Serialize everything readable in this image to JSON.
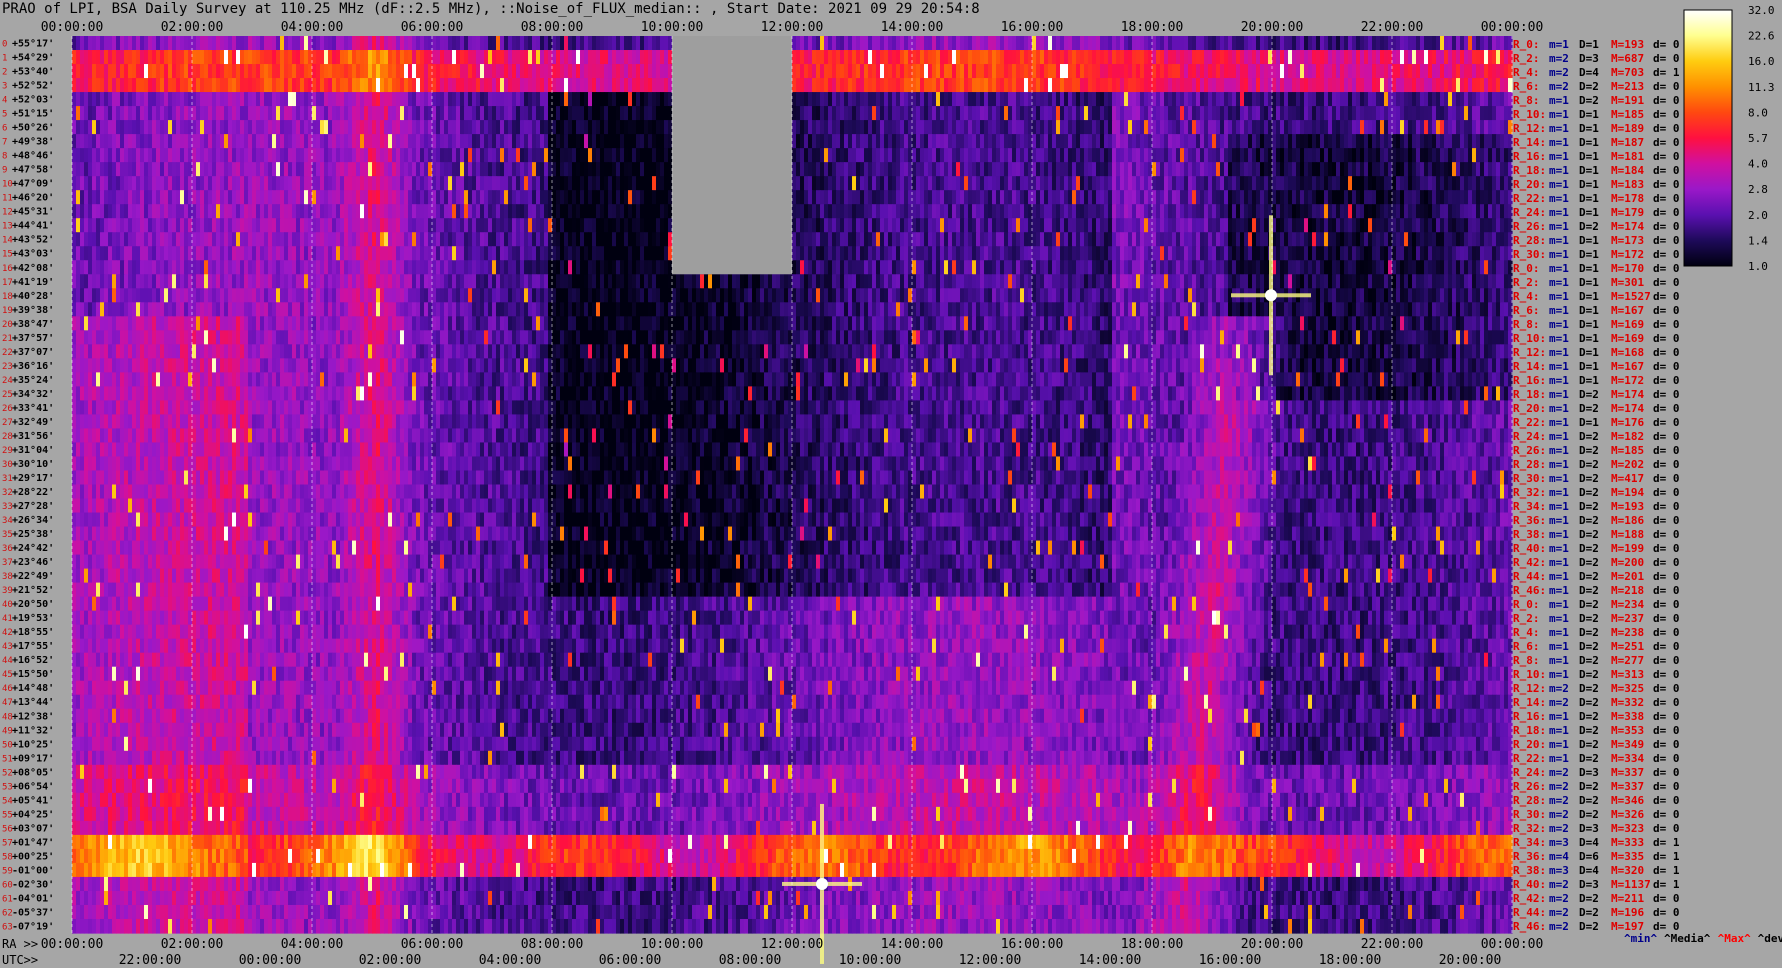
{
  "title": "PRAO of LPI, BSA Daily Survey at 110.25 MHz (dF::2.5 MHz), ::Noise_of_FLUX_median:: , Start Date: 2021 09 29 20:54:8",
  "chart_data": {
    "type": "heatmap",
    "top_time_labels": [
      "00:00:00",
      "02:00:00",
      "04:00:00",
      "06:00:00",
      "08:00:00",
      "10:00:00",
      "12:00:00",
      "14:00:00",
      "16:00:00",
      "18:00:00",
      "20:00:00",
      "22:00:00",
      "00:00:00"
    ],
    "ra_label": "RA >>",
    "ra_ticks": [
      "00:00:00",
      "02:00:00",
      "04:00:00",
      "06:00:00",
      "08:00:00",
      "10:00:00",
      "12:00:00",
      "14:00:00",
      "16:00:00",
      "18:00:00",
      "20:00:00",
      "22:00:00",
      "00:00:00"
    ],
    "utc_label": "UTC>>",
    "utc_ticks": [
      "22:00:00",
      "00:00:00",
      "02:00:00",
      "04:00:00",
      "06:00:00",
      "08:00:00",
      "10:00:00",
      "12:00:00",
      "14:00:00",
      "16:00:00",
      "18:00:00",
      "20:00:00"
    ],
    "declinations": [
      "+55°17'",
      "+54°29'",
      "+53°40'",
      "+52°52'",
      "+52°03'",
      "+51°15'",
      "+50°26'",
      "+49°38'",
      "+48°46'",
      "+47°58'",
      "+47°09'",
      "+46°20'",
      "+45°31'",
      "+44°41'",
      "+43°52'",
      "+43°03'",
      "+42°08'",
      "+41°19'",
      "+40°28'",
      "+39°38'",
      "+38°47'",
      "+37°57'",
      "+37°07'",
      "+36°16'",
      "+35°24'",
      "+34°32'",
      "+33°41'",
      "+32°49'",
      "+31°56'",
      "+31°04'",
      "+30°10'",
      "+29°17'",
      "+28°22'",
      "+27°28'",
      "+26°34'",
      "+25°38'",
      "+24°42'",
      "+23°46'",
      "+22°49'",
      "+21°52'",
      "+20°50'",
      "+19°53'",
      "+18°55'",
      "+17°55'",
      "+16°52'",
      "+15°50'",
      "+14°48'",
      "+13°44'",
      "+12°38'",
      "+11°32'",
      "+10°25'",
      "+09°17'",
      "+08°05'",
      "+06°54'",
      "+05°41'",
      "+04°25'",
      "+03°07'",
      "+01°47'",
      "+00°25'",
      "-01°00'",
      "-02°30'",
      "-04°01'",
      "-05°37'",
      "-07°19'"
    ],
    "colorbar_ticks": [
      "32.0",
      "22.6",
      "16.0",
      "11.3",
      "8.0",
      "5.7",
      "4.0",
      "2.8",
      "2.0",
      "1.4",
      "1.0"
    ],
    "colorbar_colors": [
      "#000010",
      "#1e0a5a",
      "#5a10b0",
      "#9a18c8",
      "#d010a0",
      "#ff1040",
      "#ff4810",
      "#ff9000",
      "#ffcc10",
      "#ffff90",
      "#ffffff"
    ],
    "color_scale": "log",
    "masked_region": {
      "ra_from": "10:00:00",
      "ra_to": "12:00:00",
      "dec_from": "+55°17'",
      "dec_to": "+42°08'"
    },
    "bright_sources": [
      {
        "ra": "19:59:00",
        "dec": "+40°28'",
        "name_shown": false
      },
      {
        "ra": "12:30:00",
        "dec": "-02°30'",
        "name_shown": false
      }
    ],
    "stats": [
      {
        "r": "R_0:",
        "m": "m=1",
        "d": "D=1",
        "mx": "M=193",
        "dv": "d= 0"
      },
      {
        "r": "R_2:",
        "m": "m=2",
        "d": "D=3",
        "mx": "M=687",
        "dv": "d= 0"
      },
      {
        "r": "R_4:",
        "m": "m=2",
        "d": "D=4",
        "mx": "M=703",
        "dv": "d= 1"
      },
      {
        "r": "R_6:",
        "m": "m=2",
        "d": "D=2",
        "mx": "M=213",
        "dv": "d= 0"
      },
      {
        "r": "R_8:",
        "m": "m=1",
        "d": "D=2",
        "mx": "M=191",
        "dv": "d= 0"
      },
      {
        "r": "R_10:",
        "m": "m=1",
        "d": "D=1",
        "mx": "M=185",
        "dv": "d= 0"
      },
      {
        "r": "R_12:",
        "m": "m=1",
        "d": "D=1",
        "mx": "M=189",
        "dv": "d= 0"
      },
      {
        "r": "R_14:",
        "m": "m=1",
        "d": "D=1",
        "mx": "M=187",
        "dv": "d= 0"
      },
      {
        "r": "R_16:",
        "m": "m=1",
        "d": "D=1",
        "mx": "M=181",
        "dv": "d= 0"
      },
      {
        "r": "R_18:",
        "m": "m=1",
        "d": "D=1",
        "mx": "M=184",
        "dv": "d= 0"
      },
      {
        "r": "R_20:",
        "m": "m=1",
        "d": "D=1",
        "mx": "M=183",
        "dv": "d= 0"
      },
      {
        "r": "R_22:",
        "m": "m=1",
        "d": "D=1",
        "mx": "M=178",
        "dv": "d= 0"
      },
      {
        "r": "R_24:",
        "m": "m=1",
        "d": "D=1",
        "mx": "M=179",
        "dv": "d= 0"
      },
      {
        "r": "R_26:",
        "m": "m=1",
        "d": "D=2",
        "mx": "M=174",
        "dv": "d= 0"
      },
      {
        "r": "R_28:",
        "m": "m=1",
        "d": "D=1",
        "mx": "M=173",
        "dv": "d= 0"
      },
      {
        "r": "R_30:",
        "m": "m=1",
        "d": "D=1",
        "mx": "M=172",
        "dv": "d= 0"
      },
      {
        "r": "R_0:",
        "m": "m=1",
        "d": "D=1",
        "mx": "M=170",
        "dv": "d= 0"
      },
      {
        "r": "R_2:",
        "m": "m=1",
        "d": "D=1",
        "mx": "M=301",
        "dv": "d= 0"
      },
      {
        "r": "R_4:",
        "m": "m=1",
        "d": "D=1",
        "mx": "M=1527",
        "dv": "d= 0"
      },
      {
        "r": "R_6:",
        "m": "m=1",
        "d": "D=1",
        "mx": "M=167",
        "dv": "d= 0"
      },
      {
        "r": "R_8:",
        "m": "m=1",
        "d": "D=1",
        "mx": "M=169",
        "dv": "d= 0"
      },
      {
        "r": "R_10:",
        "m": "m=1",
        "d": "D=1",
        "mx": "M=169",
        "dv": "d= 0"
      },
      {
        "r": "R_12:",
        "m": "m=1",
        "d": "D=1",
        "mx": "M=168",
        "dv": "d= 0"
      },
      {
        "r": "R_14:",
        "m": "m=1",
        "d": "D=1",
        "mx": "M=167",
        "dv": "d= 0"
      },
      {
        "r": "R_16:",
        "m": "m=1",
        "d": "D=1",
        "mx": "M=172",
        "dv": "d= 0"
      },
      {
        "r": "R_18:",
        "m": "m=1",
        "d": "D=2",
        "mx": "M=174",
        "dv": "d= 0"
      },
      {
        "r": "R_20:",
        "m": "m=1",
        "d": "D=2",
        "mx": "M=174",
        "dv": "d= 0"
      },
      {
        "r": "R_22:",
        "m": "m=1",
        "d": "D=1",
        "mx": "M=176",
        "dv": "d= 0"
      },
      {
        "r": "R_24:",
        "m": "m=1",
        "d": "D=2",
        "mx": "M=182",
        "dv": "d= 0"
      },
      {
        "r": "R_26:",
        "m": "m=1",
        "d": "D=2",
        "mx": "M=185",
        "dv": "d= 0"
      },
      {
        "r": "R_28:",
        "m": "m=1",
        "d": "D=2",
        "mx": "M=202",
        "dv": "d= 0"
      },
      {
        "r": "R_30:",
        "m": "m=1",
        "d": "D=2",
        "mx": "M=417",
        "dv": "d= 0"
      },
      {
        "r": "R_32:",
        "m": "m=1",
        "d": "D=2",
        "mx": "M=194",
        "dv": "d= 0"
      },
      {
        "r": "R_34:",
        "m": "m=1",
        "d": "D=2",
        "mx": "M=193",
        "dv": "d= 0"
      },
      {
        "r": "R_36:",
        "m": "m=1",
        "d": "D=2",
        "mx": "M=186",
        "dv": "d= 0"
      },
      {
        "r": "R_38:",
        "m": "m=1",
        "d": "D=2",
        "mx": "M=188",
        "dv": "d= 0"
      },
      {
        "r": "R_40:",
        "m": "m=1",
        "d": "D=2",
        "mx": "M=199",
        "dv": "d= 0"
      },
      {
        "r": "R_42:",
        "m": "m=1",
        "d": "D=2",
        "mx": "M=200",
        "dv": "d= 0"
      },
      {
        "r": "R_44:",
        "m": "m=1",
        "d": "D=2",
        "mx": "M=201",
        "dv": "d= 0"
      },
      {
        "r": "R_46:",
        "m": "m=1",
        "d": "D=2",
        "mx": "M=218",
        "dv": "d= 0"
      },
      {
        "r": "R_0:",
        "m": "m=1",
        "d": "D=2",
        "mx": "M=234",
        "dv": "d= 0"
      },
      {
        "r": "R_2:",
        "m": "m=1",
        "d": "D=2",
        "mx": "M=237",
        "dv": "d= 0"
      },
      {
        "r": "R_4:",
        "m": "m=1",
        "d": "D=2",
        "mx": "M=238",
        "dv": "d= 0"
      },
      {
        "r": "R_6:",
        "m": "m=1",
        "d": "D=2",
        "mx": "M=251",
        "dv": "d= 0"
      },
      {
        "r": "R_8:",
        "m": "m=1",
        "d": "D=2",
        "mx": "M=277",
        "dv": "d= 0"
      },
      {
        "r": "R_10:",
        "m": "m=1",
        "d": "D=2",
        "mx": "M=313",
        "dv": "d= 0"
      },
      {
        "r": "R_12:",
        "m": "m=2",
        "d": "D=2",
        "mx": "M=325",
        "dv": "d= 0"
      },
      {
        "r": "R_14:",
        "m": "m=2",
        "d": "D=2",
        "mx": "M=332",
        "dv": "d= 0"
      },
      {
        "r": "R_16:",
        "m": "m=1",
        "d": "D=2",
        "mx": "M=338",
        "dv": "d= 0"
      },
      {
        "r": "R_18:",
        "m": "m=1",
        "d": "D=2",
        "mx": "M=353",
        "dv": "d= 0"
      },
      {
        "r": "R_20:",
        "m": "m=1",
        "d": "D=2",
        "mx": "M=349",
        "dv": "d= 0"
      },
      {
        "r": "R_22:",
        "m": "m=1",
        "d": "D=2",
        "mx": "M=334",
        "dv": "d= 0"
      },
      {
        "r": "R_24:",
        "m": "m=2",
        "d": "D=3",
        "mx": "M=337",
        "dv": "d= 0"
      },
      {
        "r": "R_26:",
        "m": "m=2",
        "d": "D=2",
        "mx": "M=337",
        "dv": "d= 0"
      },
      {
        "r": "R_28:",
        "m": "m=2",
        "d": "D=2",
        "mx": "M=346",
        "dv": "d= 0"
      },
      {
        "r": "R_30:",
        "m": "m=2",
        "d": "D=2",
        "mx": "M=326",
        "dv": "d= 0"
      },
      {
        "r": "R_32:",
        "m": "m=2",
        "d": "D=3",
        "mx": "M=323",
        "dv": "d= 0"
      },
      {
        "r": "R_34:",
        "m": "m=3",
        "d": "D=4",
        "mx": "M=333",
        "dv": "d= 1"
      },
      {
        "r": "R_36:",
        "m": "m=4",
        "d": "D=6",
        "mx": "M=335",
        "dv": "d= 1"
      },
      {
        "r": "R_38:",
        "m": "m=3",
        "d": "D=4",
        "mx": "M=320",
        "dv": "d= 1"
      },
      {
        "r": "R_40:",
        "m": "m=2",
        "d": "D=3",
        "mx": "M=1137",
        "dv": "d= 1"
      },
      {
        "r": "R_42:",
        "m": "m=2",
        "d": "D=2",
        "mx": "M=211",
        "dv": "d= 0"
      },
      {
        "r": "R_44:",
        "m": "m=2",
        "d": "D=2",
        "mx": "M=196",
        "dv": "d= 0"
      },
      {
        "r": "R_46:",
        "m": "m=2",
        "d": "D=2",
        "mx": "M=197",
        "dv": "d= 0"
      }
    ],
    "legend_footer": [
      {
        "text": "^min^",
        "color": "#00008b"
      },
      {
        "text": "^Media^",
        "color": "#000000"
      },
      {
        "text": "^Max^",
        "color": "#ff0000"
      },
      {
        "text": "^devia^",
        "color": "#000000"
      }
    ]
  }
}
